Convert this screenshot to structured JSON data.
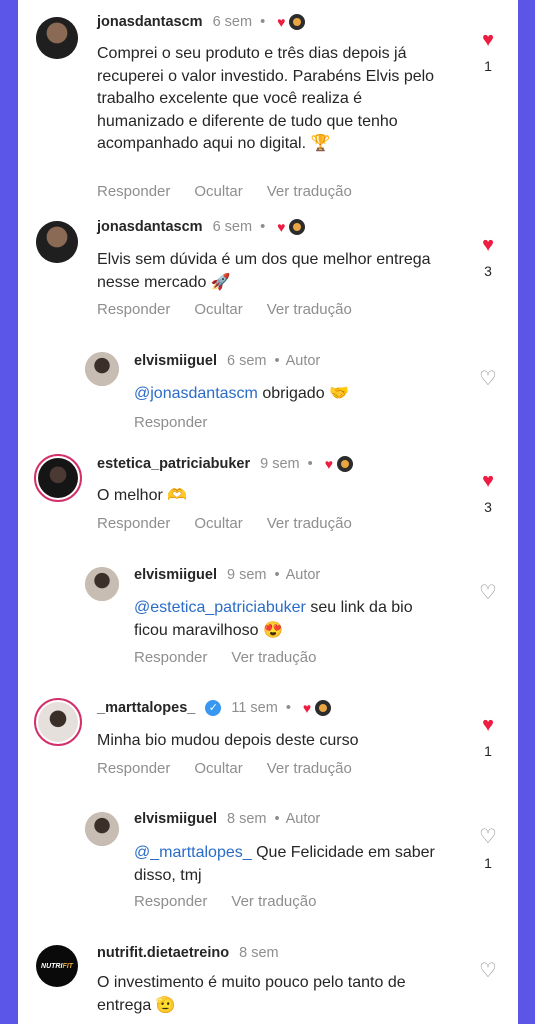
{
  "actions": {
    "reply": "Responder",
    "hide": "Ocultar",
    "translate": "Ver tradução"
  },
  "author_badge": "Autor",
  "colors": {
    "background": "#5b56e8",
    "heart": "#ed1c40",
    "mention": "#2a6cc7"
  },
  "comments": [
    {
      "user": "jonasdantascm",
      "time": "6 sem",
      "text": "Comprei o seu produto e três dias depois já recuperei o valor investido. Parabéns Elvis pelo trabalho excelente que você realiza é humanizado e diferente de tudo que tenho acompanhado aqui no digital. 🏆",
      "likes": "1"
    },
    {
      "user": "jonasdantascm",
      "time": "6 sem",
      "text": "Elvis sem dúvida é um dos que melhor entrega nesse mercado 🚀",
      "likes": "3"
    },
    {
      "user": "elvismiiguel",
      "time": "6 sem",
      "mention": "@jonasdantascm",
      "text": "obrigado 🤝"
    },
    {
      "user": "estetica_patriciabuker",
      "time": "9 sem",
      "text": "O melhor 🫶",
      "likes": "3"
    },
    {
      "user": "elvismiiguel",
      "time": "9 sem",
      "mention": "@estetica_patriciabuker",
      "text": "seu link da bio ficou maravilhoso 😍"
    },
    {
      "user": "_marttalopes_",
      "time": "11 sem",
      "text": "Minha bio mudou depois deste curso",
      "likes": "1"
    },
    {
      "user": "elvismiiguel",
      "time": "8 sem",
      "mention": "@_marttalopes_",
      "text": "Que Felicidade em saber disso, tmj",
      "likes": "1"
    },
    {
      "user": "nutrifit.dietaetreino",
      "time": "8 sem",
      "text": "O investimento é muito pouco pelo tanto de entrega 🫡"
    }
  ]
}
